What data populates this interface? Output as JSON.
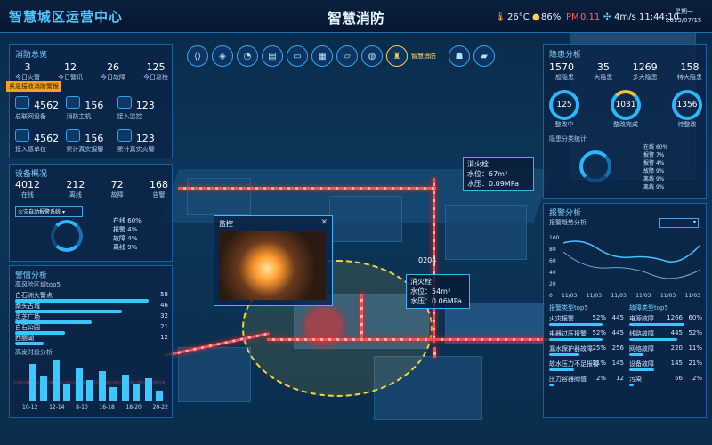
{
  "header": {
    "brand": "智慧城区运营中心",
    "title": "智慧消防",
    "temp": "26°C",
    "humidity": "86%",
    "pm": "0.11",
    "wind": "4m/s",
    "time": "11:44:10",
    "weekday": "星期一",
    "date": "2019/07/15"
  },
  "nav": {
    "icons": [
      "share-icon",
      "shield-icon",
      "gauge-icon",
      "bus-icon",
      "truck-icon",
      "building-icon",
      "map-icon",
      "globe-icon",
      "hydrant-icon",
      "walk-icon",
      "car-icon"
    ],
    "active_label": "智慧消防"
  },
  "fire": {
    "title": "消防总览",
    "stats": [
      {
        "value": "3",
        "label": "今日火警"
      },
      {
        "value": "12",
        "label": "今日警讯"
      },
      {
        "value": "26",
        "label": "今日故障"
      },
      {
        "value": "125",
        "label": "今日巡检"
      }
    ],
    "tiles": [
      {
        "value": "4562",
        "label": "总联网设备"
      },
      {
        "value": "156",
        "label": "消防主机"
      },
      {
        "value": "123",
        "label": "接入监控"
      },
      {
        "value": "4562",
        "label": "接入感单位"
      },
      {
        "value": "156",
        "label": "累计真实报警"
      },
      {
        "value": "123",
        "label": "累计真实火警"
      }
    ],
    "alert": "紧急接收消防警报"
  },
  "device": {
    "title": "设备概况",
    "stats": [
      {
        "value": "4012",
        "label": "在线"
      },
      {
        "value": "212",
        "label": "离线"
      },
      {
        "value": "72",
        "label": "故障"
      },
      {
        "value": "168",
        "label": "告警"
      }
    ],
    "select": "火灾自动报警系统",
    "legend": [
      {
        "label": "在线",
        "pct": "60%"
      },
      {
        "label": "报警",
        "pct": "4%"
      },
      {
        "label": "故障",
        "pct": "4%"
      },
      {
        "label": "离线",
        "pct": "9%"
      }
    ]
  },
  "alarm": {
    "title": "警情分析",
    "sub": "高风险区域top5",
    "rows": [
      {
        "label": "白石洲火警点",
        "value": "58"
      },
      {
        "label": "南头古城",
        "value": "46"
      },
      {
        "label": "灵芝广场",
        "value": "32"
      },
      {
        "label": "白石公园",
        "value": "21"
      },
      {
        "label": "西丽湖",
        "value": "12"
      }
    ],
    "sub2": "高发时段分析",
    "hours": [
      "10-12",
      "12-14",
      "8-10",
      "16-18",
      "18-20",
      "20-22"
    ]
  },
  "hydrant1": {
    "name": "消火栓",
    "level": "水位：67m³",
    "pressure": "水压：0.09MPa"
  },
  "hydrant2": {
    "id": "0204",
    "name": "消火栓",
    "level": "水位：54m³",
    "pressure": "水压：0.06MPa"
  },
  "monitor": {
    "title": "监控"
  },
  "hazard": {
    "title": "隐患分析",
    "stats": [
      {
        "value": "1570",
        "label": "一般隐患"
      },
      {
        "value": "35",
        "label": "大隐患"
      },
      {
        "value": "1269",
        "label": "多大隐患"
      },
      {
        "value": "158",
        "label": "特大隐患"
      }
    ],
    "rings": [
      {
        "value": "125",
        "label": "整改中"
      },
      {
        "value": "1031",
        "label": "整改完成"
      },
      {
        "value": "1356",
        "label": "待整改"
      }
    ],
    "sub": "隐患分类统计",
    "legend": [
      {
        "label": "在线",
        "pct": "60%"
      },
      {
        "label": "报警",
        "pct": "7%"
      },
      {
        "label": "报警",
        "pct": "4%"
      },
      {
        "label": "故障",
        "pct": "9%"
      },
      {
        "label": "离线",
        "pct": "9%"
      },
      {
        "label": "离线",
        "pct": "9%"
      }
    ]
  },
  "trend": {
    "title": "报警分析",
    "sub": "报警趋势分析",
    "select": "",
    "y": [
      "100",
      "80",
      "60",
      "40",
      "20",
      "0"
    ],
    "x": [
      "11/03",
      "11/03",
      "11/03",
      "11/03",
      "11/03",
      "11/03"
    ]
  },
  "types": {
    "left_title": "报警类型top5",
    "right_title": "故障类型top5",
    "left": [
      {
        "label": "火灾报警",
        "value": "445",
        "pct": "52%"
      },
      {
        "label": "电器过压报警",
        "value": "445",
        "pct": "52%"
      },
      {
        "label": "漏水保护器故障",
        "value": "256",
        "pct": "25%"
      },
      {
        "label": "故水压力不足报警",
        "value": "145",
        "pct": "21%"
      },
      {
        "label": "压力容器阀值",
        "value": "12",
        "pct": "2%"
      }
    ],
    "right": [
      {
        "label": "电源故障",
        "value": "1266",
        "pct": "60%"
      },
      {
        "label": "线路故障",
        "value": "445",
        "pct": "52%"
      },
      {
        "label": "网络故障",
        "value": "220",
        "pct": "11%"
      },
      {
        "label": "设备故障",
        "value": "145",
        "pct": "21%"
      },
      {
        "label": "污染",
        "value": "56",
        "pct": "2%"
      }
    ]
  }
}
